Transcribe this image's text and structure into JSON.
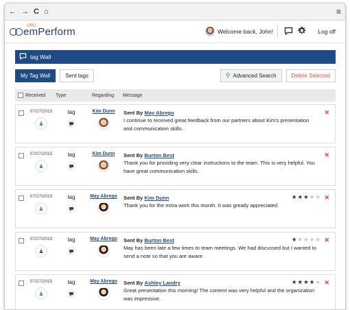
{
  "browser": {
    "back": "←",
    "forward": "→",
    "reload": "C",
    "home": "⌂",
    "menu": "≡"
  },
  "app": {
    "logo_org": "ORG",
    "logo_text": "emPerform",
    "welcome": "Welcome back, John!",
    "logoff": "Log off"
  },
  "panel": {
    "title": "tag Wall"
  },
  "toolbar": {
    "my_tag_wall": "My Tag Wall",
    "sent_tags": "Sent tags",
    "advanced_search": "Advanced Search",
    "delete_selected": "Delete Selected"
  },
  "table": {
    "headers": {
      "received": "Received",
      "type": "Type",
      "regarding": "Regarding",
      "message": "Message"
    }
  },
  "sent_by_prefix": "Sent By",
  "rows": [
    {
      "date": "07/27/2015",
      "type": "tag",
      "regarding": "Kim Dunn",
      "sender": "May Abrego",
      "message": "I continue to received great feedback from our partners about Kim's presentation and communication skills.",
      "stars": 0,
      "icon": "green"
    },
    {
      "date": "07/27/2015",
      "type": "tag",
      "regarding": "Kim Dunn",
      "sender": "Burton Best",
      "message": "Thank you for providing very clear instructions to the team. This is very helpful. You have great communication skills.",
      "stars": 0,
      "icon": "green"
    },
    {
      "date": "07/27/2015",
      "type": "tag",
      "regarding": "May Abrego",
      "sender": "Kim Dunn",
      "message": "Thank you for the extra work this month. It was greatly appreciated.",
      "stars": 3,
      "icon": "green"
    },
    {
      "date": "07/27/2015",
      "type": "tag",
      "regarding": "May Abrego",
      "sender": "Burton Best",
      "message": "May has been late a few times to team meetings. We had discussed but I wanted to send a note so that you are aware.",
      "stars": 1,
      "icon": "grey"
    },
    {
      "date": "07/27/2015",
      "type": "tag",
      "regarding": "May Abrego",
      "sender": "Ashley Landry",
      "message": "Great presentation this morning! The content was very helpful and the organization was impressive.",
      "stars": 4,
      "icon": "green"
    }
  ]
}
